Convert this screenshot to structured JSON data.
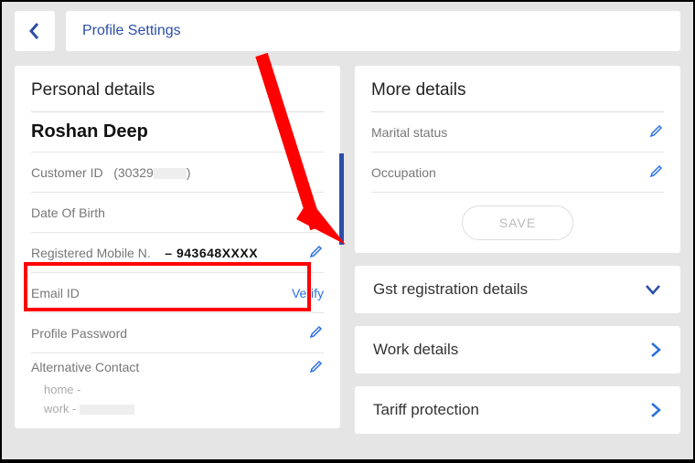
{
  "header": {
    "title": "Profile Settings"
  },
  "personal": {
    "title": "Personal details",
    "name": "Roshan Deep",
    "customer_id_label": "Customer ID",
    "customer_id_value": "(30329",
    "customer_id_tail": ")",
    "dob_label": "Date Of Birth",
    "mobile_label": "Registered Mobile N.",
    "mobile_value": "– 943648XXXX",
    "email_label": "Email ID",
    "verify_label": "Verify",
    "password_label": "Profile Password",
    "alt_label": "Alternative Contact",
    "alt_home": "home  -",
    "alt_work": "work  -"
  },
  "more": {
    "title": "More details",
    "marital_label": "Marital status",
    "occupation_label": "Occupation",
    "save_label": "SAVE"
  },
  "accordions": {
    "gst": "Gst registration details",
    "work": "Work details",
    "tariff": "Tariff protection"
  }
}
